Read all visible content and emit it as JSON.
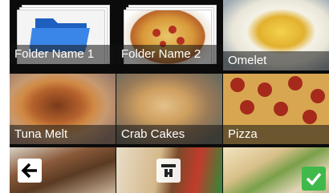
{
  "tiles": [
    {
      "label": "Folder Name 1",
      "type": "folder",
      "icon": "folder-icon"
    },
    {
      "label": "Folder Name 2",
      "type": "folder",
      "icon": "pizza-photo"
    },
    {
      "label": "Omelet",
      "type": "food"
    },
    {
      "label": "Tuna Melt",
      "type": "food"
    },
    {
      "label": "Crab Cakes",
      "type": "food"
    },
    {
      "label": "Pizza",
      "type": "food"
    },
    {
      "label": "",
      "type": "food"
    },
    {
      "label": "",
      "type": "food"
    },
    {
      "label": "",
      "type": "food"
    }
  ],
  "controls": {
    "back_icon": "back-arrow-icon",
    "pager_icon": "page-jump-icon",
    "confirm_icon": "checkmark-icon"
  },
  "colors": {
    "background": "#0b0b0b",
    "confirm": "#3fb94a",
    "folder": "#2a6fd6"
  }
}
